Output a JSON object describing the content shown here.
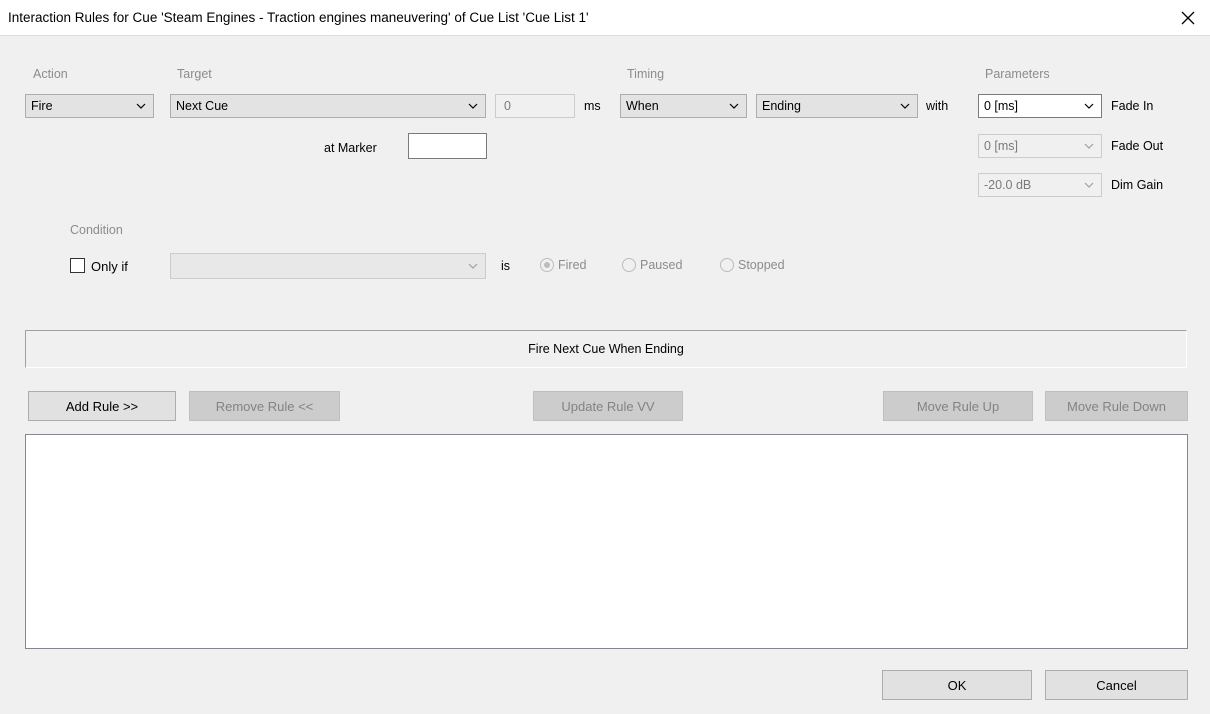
{
  "window": {
    "title": "Interaction Rules for Cue 'Steam Engines - Traction engines maneuvering' of Cue List 'Cue List 1'",
    "close_icon": "close-icon"
  },
  "labels": {
    "action": "Action",
    "target": "Target",
    "timing": "Timing",
    "parameters": "Parameters",
    "ms": "ms",
    "with": "with",
    "at_marker": "at Marker",
    "condition": "Condition",
    "is": "is"
  },
  "action": {
    "value": "Fire"
  },
  "target": {
    "value": "Next Cue"
  },
  "delay": {
    "value": "0"
  },
  "marker": {
    "value": ""
  },
  "timing": {
    "when": "When",
    "event": "Ending"
  },
  "parameters": {
    "fade_in": {
      "value": "0 [ms]",
      "label": "Fade In"
    },
    "fade_out": {
      "value": "0 [ms]",
      "label": "Fade Out"
    },
    "dim_gain": {
      "value": "-20.0 dB",
      "label": "Dim Gain"
    }
  },
  "condition": {
    "only_if_label": "Only if",
    "only_if_checked": false,
    "cue_value": "",
    "options": [
      "Fired",
      "Paused",
      "Stopped"
    ],
    "selected": "Fired"
  },
  "summary": {
    "text": "Fire Next Cue  When Ending"
  },
  "buttons": {
    "add_rule": "Add Rule >>",
    "remove_rule": "Remove Rule <<",
    "update_rule": "Update Rule VV",
    "move_up": "Move Rule Up",
    "move_down": "Move Rule Down",
    "ok": "OK",
    "cancel": "Cancel"
  },
  "rules_list": {
    "items": []
  }
}
